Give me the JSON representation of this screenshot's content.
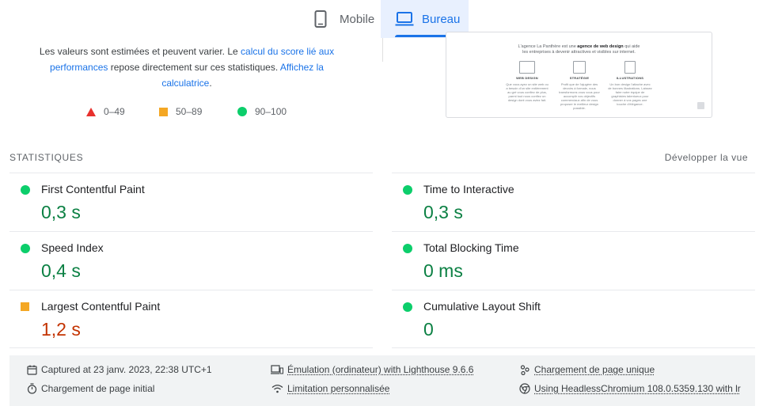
{
  "tabs": {
    "mobile": {
      "label": "Mobile",
      "icon": "phone-icon"
    },
    "desktop": {
      "label": "Bureau",
      "icon": "laptop-icon",
      "active": true
    }
  },
  "score_description": {
    "part1": "Les valeurs sont estimées et peuvent varier. Le ",
    "link1": "calcul du score lié aux performances",
    "part2": " repose directement sur ces statistiques. ",
    "link2": "Affichez la calculatrice",
    "part3": "."
  },
  "legend": [
    {
      "range": "0–49",
      "color": "#e8312d",
      "shape": "triangle"
    },
    {
      "range": "50–89",
      "color": "#f4a724",
      "shape": "square"
    },
    {
      "range": "90–100",
      "color": "#0cce6b",
      "shape": "circle"
    }
  ],
  "screenshot_preview": {
    "headline_part1": "L'agence La Panthère est une ",
    "headline_bold": "agence de web design",
    "headline_part2": " qui aide",
    "headline_line2": "les entreprises à devenir attractives et visibles sur internet.",
    "columns": [
      {
        "title": "WEB DESIGN",
        "text": "Que vous ayez un site web ou a besoin d'un site entièrement au gré vous confiez de plus, parmi tout nous confiez un design dont vous aviez fait."
      },
      {
        "title": "STRATÉGIE",
        "text": "Profit que de l'ajugère des devoirs à formale, nous transformons vous vous pour accomplir vos objectifs commerciaux afin de vous proposer le meilleur design possible."
      },
      {
        "title": "ILLUSTRATIONS",
        "text": "Un bon design l'attache avec de bonnes illustrations. Laissez faire notre équipe de graphistes talentueux pour donner à vos pages une touche d'élégance."
      }
    ]
  },
  "statistics": {
    "title": "STATISTIQUES",
    "expand_label": "Développer la vue",
    "metrics": [
      {
        "name": "First Contentful Paint",
        "value": "0,3 s",
        "rating": "good"
      },
      {
        "name": "Time to Interactive",
        "value": "0,3 s",
        "rating": "good"
      },
      {
        "name": "Speed Index",
        "value": "0,4 s",
        "rating": "good"
      },
      {
        "name": "Total Blocking Time",
        "value": "0 ms",
        "rating": "good"
      },
      {
        "name": "Largest Contentful Paint",
        "value": "1,2 s",
        "rating": "average"
      },
      {
        "name": "Cumulative Layout Shift",
        "value": "0",
        "rating": "good"
      }
    ]
  },
  "footer": {
    "captured": "Captured at 23 janv. 2023, 22:38 UTC+1",
    "emulation": "Émulation (ordinateur) with Lighthouse 9.6.6",
    "single_load": "Chargement de page unique",
    "initial_load": "Chargement de page initial",
    "throttling": "Limitation personnalisée",
    "browser": "Using HeadlessChromium 108.0.5359.130 with lr"
  },
  "colors": {
    "accent": "#1a73e8",
    "good": "#0cce6b",
    "good_text": "#0b8043",
    "average": "#f4a724",
    "average_text": "#c33300",
    "poor": "#e8312d"
  }
}
